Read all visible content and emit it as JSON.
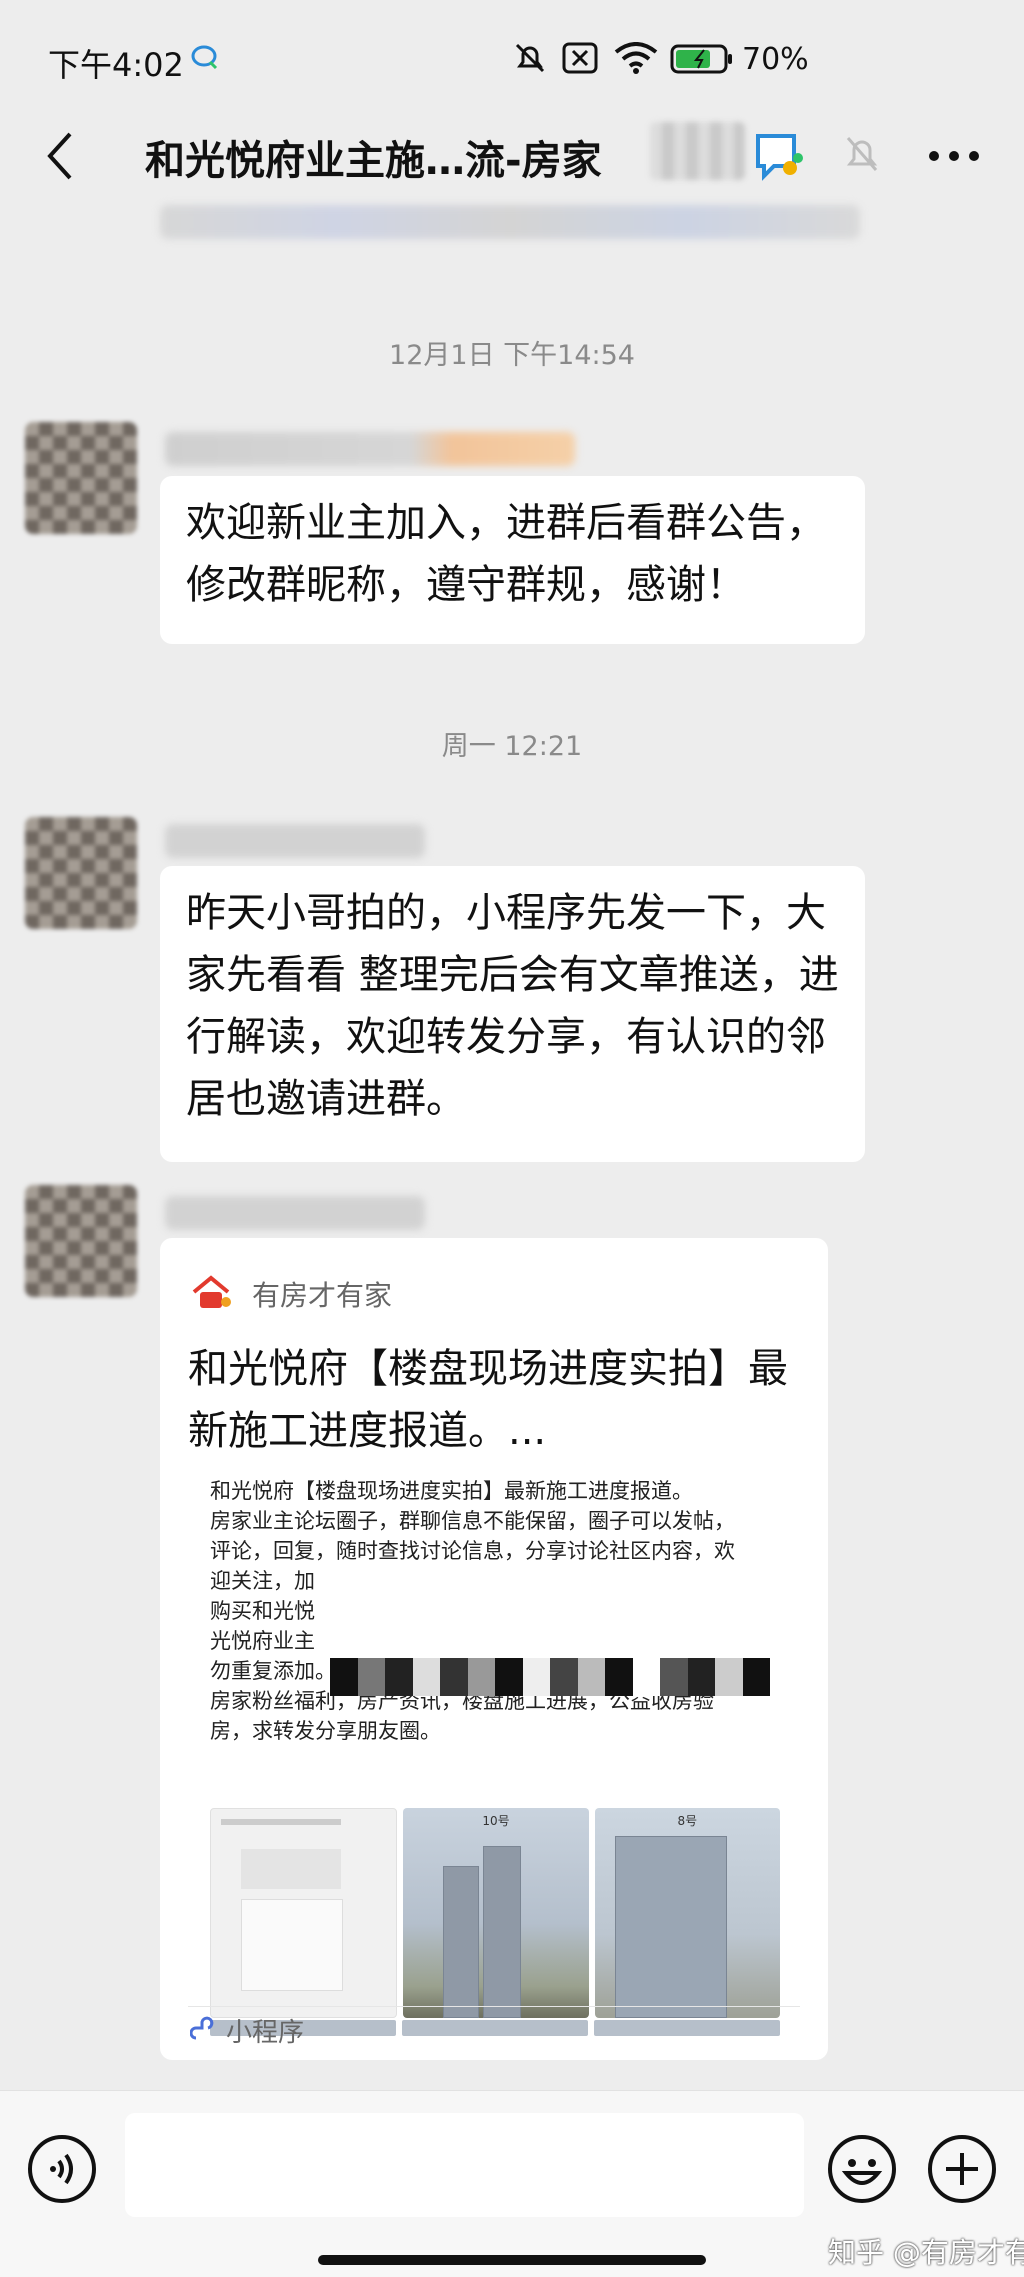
{
  "status_bar": {
    "time": "下午4:02",
    "battery": "70%"
  },
  "header": {
    "title": "和光悦府业主施…流-房家",
    "back_icon": "back-arrow-icon",
    "mute_icon": "bell-muted-icon",
    "more_icon": "more-dots-icon"
  },
  "messages": [
    {
      "timestamp": "12月1日 下午14:54",
      "text": "欢迎新业主加入，进群后看群公告，修改群昵称，遵守群规，感谢！"
    },
    {
      "timestamp": "周一 12:21",
      "text": "昨天小哥拍的，小程序先发一下，大家先看看 整理完后会有文章推送，进行解读，欢迎转发分享，有认识的邻居也邀请进群。"
    }
  ],
  "card": {
    "source": "有房才有家",
    "title": "和光悦府【楼盘现场进度实拍】最新施工进度报道。...",
    "image_text": [
      "和光悦府【楼盘现场进度实拍】最新施工进度报道。",
      "房家业主论坛圈子，群聊信息不能保留，圈子可以发帖，",
      "评论，回复，随时查找讨论信息，分享讨论社区内容，欢",
      "迎关注，加",
      "购买和光悦",
      "光悦府业主",
      "勿重复添加。",
      "房家粉丝福利，房产资讯，楼盘施工进展，公益收房验",
      "房，求转发分享朋友圈。"
    ],
    "thumb_labels": [
      "10号",
      "8号"
    ],
    "type_label": "小程序"
  },
  "input_bar": {
    "placeholder": "",
    "voice_icon": "voice-icon",
    "emoji_icon": "emoji-icon",
    "plus_icon": "plus-icon"
  },
  "watermark": "知乎 @有房才有家"
}
